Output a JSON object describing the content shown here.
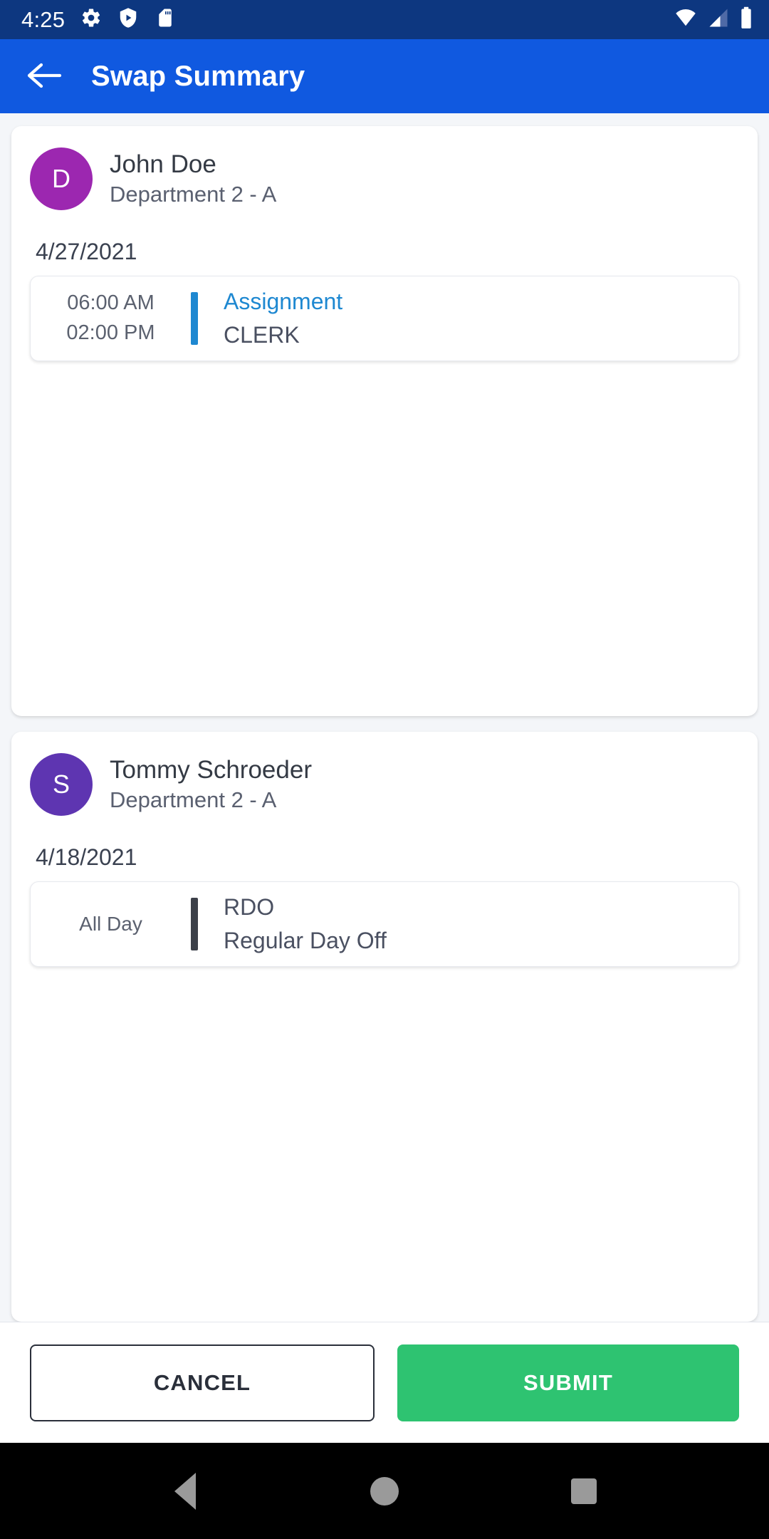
{
  "status_bar": {
    "clock": "4:25",
    "left_icons": [
      "gear-icon",
      "shield-play-icon",
      "sd-card-icon"
    ],
    "right_icons": [
      "wifi-icon",
      "cell-signal-icon",
      "battery-icon"
    ],
    "background_color": "#0d3780"
  },
  "app_bar": {
    "back_icon": "arrow-left-icon",
    "title": "Swap Summary",
    "background_color": "#1059e0"
  },
  "cards": [
    {
      "avatar_letter": "D",
      "avatar_color": "#9c27b0",
      "name": "John Doe",
      "department": "Department 2 - A",
      "date": "4/27/2021",
      "shift": {
        "start_time": "06:00 AM",
        "end_time": "02:00 PM",
        "all_day_label": "",
        "accent_color": "#1e88d1",
        "type": "Assignment",
        "type_color": "#1e88d1",
        "detail": "CLERK"
      }
    },
    {
      "avatar_letter": "S",
      "avatar_color": "#5e35b1",
      "name": "Tommy Schroeder",
      "department": "Department 2 - A",
      "date": "4/18/2021",
      "shift": {
        "start_time": "",
        "end_time": "",
        "all_day_label": "All Day",
        "accent_color": "#3c4049",
        "type": "RDO",
        "type_color": "#4a5061",
        "detail": "Regular Day Off"
      }
    }
  ],
  "actions": {
    "cancel_label": "CANCEL",
    "submit_label": "SUBMIT",
    "submit_color": "#2ec371"
  },
  "nav_bar": {
    "back_icon": "triangle-back-icon",
    "home_icon": "circle-home-icon",
    "recents_icon": "square-recents-icon"
  }
}
